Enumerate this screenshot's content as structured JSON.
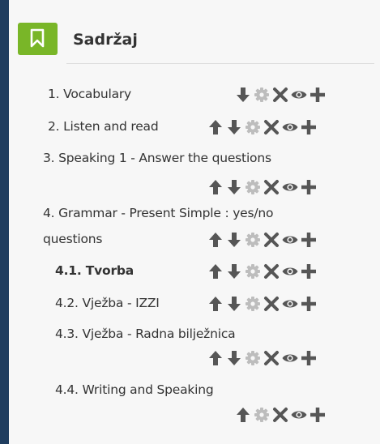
{
  "panel": {
    "title": "Sadržaj",
    "header_icon": "bookmark-icon"
  },
  "colors": {
    "accent": "#79b628",
    "icon": "#565656",
    "gear": "#bdbdbd",
    "background_outer": "#1f3d5f"
  },
  "items": [
    {
      "label": "1. Vocabulary",
      "bold": false,
      "controls": [
        "down",
        "gear",
        "delete",
        "eye",
        "add"
      ]
    },
    {
      "label": "2. Listen and read",
      "bold": false,
      "controls": [
        "up",
        "down",
        "gear",
        "delete",
        "eye",
        "add"
      ]
    },
    {
      "label": "3. Speaking 1 - Answer the questions",
      "bold": false,
      "controls": [
        "up",
        "down",
        "gear",
        "delete",
        "eye",
        "add"
      ]
    },
    {
      "label": "4. Grammar - Present Simple : yes/no",
      "label2": "questions",
      "bold": false,
      "controls": [
        "up",
        "down",
        "gear",
        "delete",
        "eye",
        "add"
      ]
    },
    {
      "label": "4.1. Tvorba",
      "bold": true,
      "controls": [
        "up",
        "down",
        "gear",
        "delete",
        "eye",
        "add"
      ]
    },
    {
      "label": "4.2. Vježba - IZZI",
      "bold": false,
      "controls": [
        "up",
        "down",
        "gear",
        "delete",
        "eye",
        "add"
      ]
    },
    {
      "label": "4.3. Vježba - Radna bilježnica",
      "bold": false,
      "controls": [
        "up",
        "down",
        "gear",
        "delete",
        "eye",
        "add"
      ]
    },
    {
      "label": "4.4. Writing and Speaking",
      "bold": false,
      "controls": [
        "up",
        "gear",
        "delete",
        "eye",
        "add"
      ]
    }
  ]
}
